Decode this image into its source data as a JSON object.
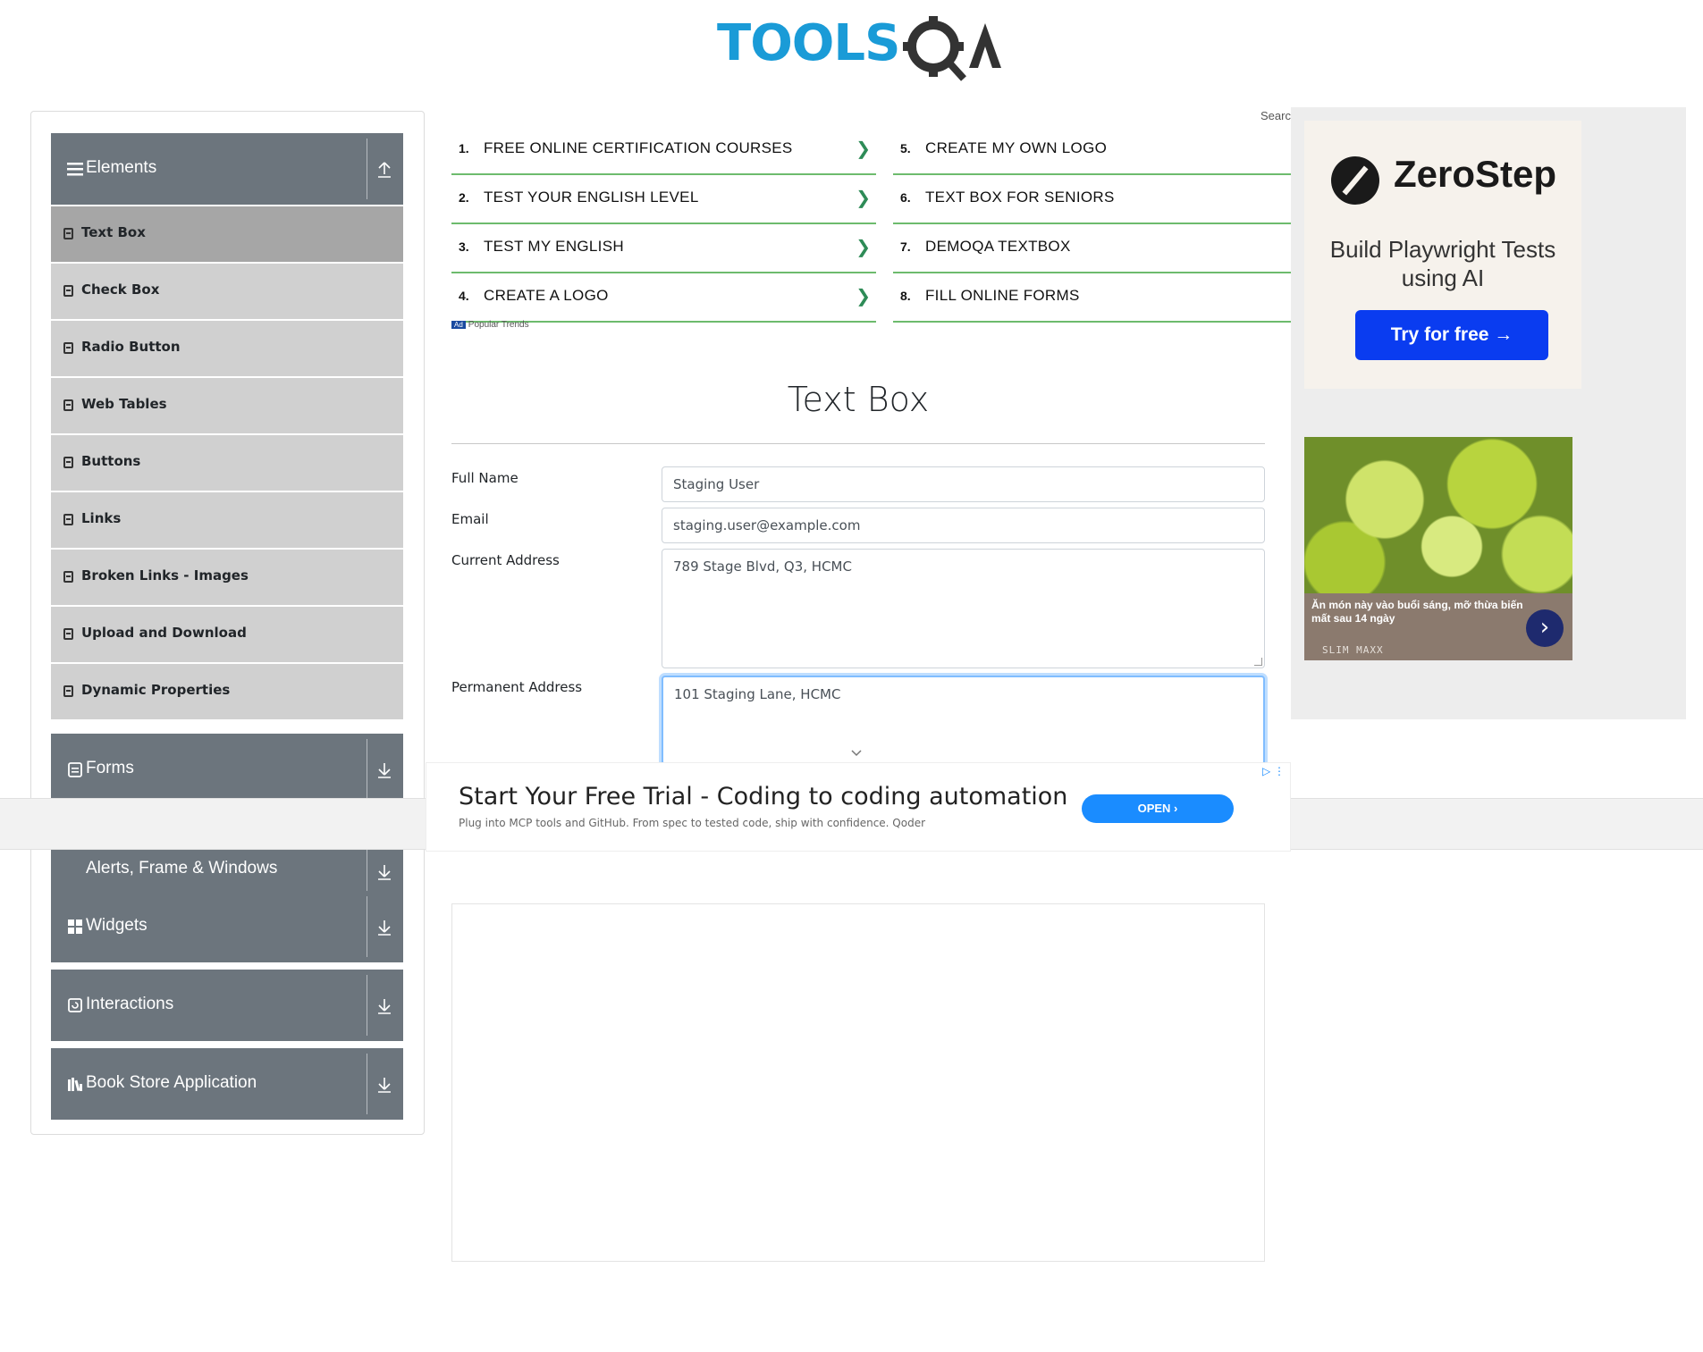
{
  "logo": {
    "text_part": "TOOLS",
    "qa_part": "QA"
  },
  "sidebar": {
    "groups": [
      {
        "title": "Elements"
      },
      {
        "title": "Forms"
      },
      {
        "title": "Alerts, Frame & Windows"
      },
      {
        "title": "Widgets"
      },
      {
        "title": "Interactions"
      },
      {
        "title": "Book Store Application"
      }
    ],
    "items": [
      {
        "label": "Text Box"
      },
      {
        "label": "Check Box"
      },
      {
        "label": "Radio Button"
      },
      {
        "label": "Web Tables"
      },
      {
        "label": "Buttons"
      },
      {
        "label": "Links"
      },
      {
        "label": "Broken Links - Images"
      },
      {
        "label": "Upload and Download"
      },
      {
        "label": "Dynamic Properties"
      }
    ]
  },
  "ad_links": {
    "search_cut": "Searc",
    "popular": "Popular Trends",
    "ad_badge": "Ad",
    "rows": [
      {
        "num": "1.",
        "text": "FREE ONLINE CERTIFICATION COURSES"
      },
      {
        "num": "2.",
        "text": "TEST YOUR ENGLISH LEVEL"
      },
      {
        "num": "3.",
        "text": "TEST MY ENGLISH"
      },
      {
        "num": "4.",
        "text": "CREATE A LOGO"
      },
      {
        "num": "5.",
        "text": "CREATE MY OWN LOGO"
      },
      {
        "num": "6.",
        "text": "TEXT BOX FOR SENIORS"
      },
      {
        "num": "7.",
        "text": "DEMOQA TEXTBOX"
      },
      {
        "num": "8.",
        "text": "FILL ONLINE FORMS"
      }
    ]
  },
  "form": {
    "title": "Text Box",
    "full_name_label": "Full Name",
    "full_name_value": "Staging User",
    "email_label": "Email",
    "email_value": "staging.user@example.com",
    "current_address_label": "Current Address",
    "current_address_value": "789 Stage Blvd, Q3, HCMC",
    "permanent_address_label": "Permanent Address",
    "permanent_address_value": "101 Staging Lane, HCMC"
  },
  "right_ad": {
    "brand": "ZeroStep",
    "tagline": "Build Playwright Tests using AI",
    "cta": "Try for free →",
    "food_caption": "Ăn món này vào buổi sáng, mỡ thừa biến mất sau 14 ngày",
    "food_brand": "SLIM MAXX"
  },
  "bottom_ad": {
    "headline": "Start Your Free Trial - Coding to coding automation",
    "sub": "Plug into MCP tools and GitHub. From spec to tested code, ship with confidence. Qoder",
    "cta": "OPEN ›"
  },
  "colors": {
    "accent": "#1a9bd7",
    "group_bg": "#6c757d",
    "item_bg": "#d0d0d0",
    "item_active": "#a6a6a6",
    "link_rule": "#6dbb6d"
  }
}
